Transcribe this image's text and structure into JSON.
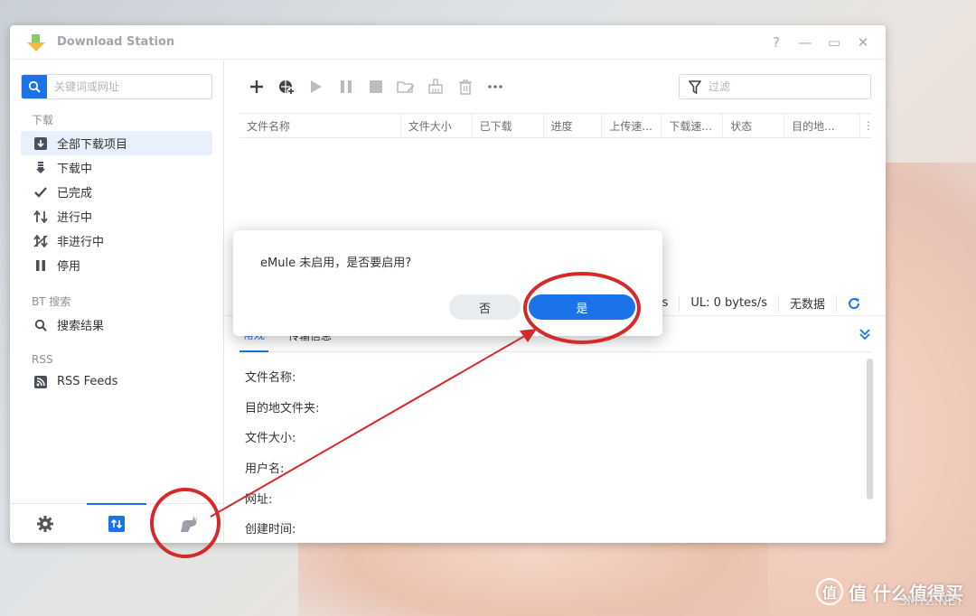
{
  "window": {
    "title": "Download Station",
    "controls": {
      "help": "?",
      "minimize": "—",
      "maximize": "▭",
      "close": "✕"
    }
  },
  "sidebar": {
    "search_placeholder": "关键词或网址",
    "sections": [
      {
        "heading": "下载"
      },
      {
        "heading": "BT 搜索"
      },
      {
        "heading": "RSS"
      }
    ],
    "download_items": [
      {
        "label": "全部下载项目",
        "icon": "download-box-icon",
        "active": true
      },
      {
        "label": "下载中",
        "icon": "downloading-icon"
      },
      {
        "label": "已完成",
        "icon": "check-icon"
      },
      {
        "label": "进行中",
        "icon": "transfer-arrows-icon"
      },
      {
        "label": "非进行中",
        "icon": "inactive-icon"
      },
      {
        "label": "停用",
        "icon": "pause-icon"
      }
    ],
    "bt_items": [
      {
        "label": "搜索结果",
        "icon": "search-icon"
      }
    ],
    "rss_items": [
      {
        "label": "RSS Feeds",
        "icon": "rss-icon"
      }
    ]
  },
  "main": {
    "filter_placeholder": "过滤",
    "columns": [
      "文件名称",
      "文件大小",
      "已下载",
      "进度",
      "上传速...",
      "下载速...",
      "状态",
      "目的地..."
    ],
    "status": {
      "dl_partial": "s",
      "ul": "UL: 0 bytes/s",
      "no_data": "无数据"
    },
    "detail_tabs": [
      "常规",
      "传输信息"
    ],
    "detail_fields": [
      "文件名称:",
      "目的地文件夹:",
      "文件大小:",
      "用户名:",
      "网址:",
      "创建时间:"
    ]
  },
  "dialog": {
    "message": "eMule 未启用，是否要启用?",
    "no_label": "否",
    "yes_label": "是"
  },
  "watermark": {
    "text": "值 什么值得买",
    "site": "SMYZ.NET"
  },
  "colors": {
    "accent": "#1a73e8",
    "annotation": "#d42a2a"
  }
}
